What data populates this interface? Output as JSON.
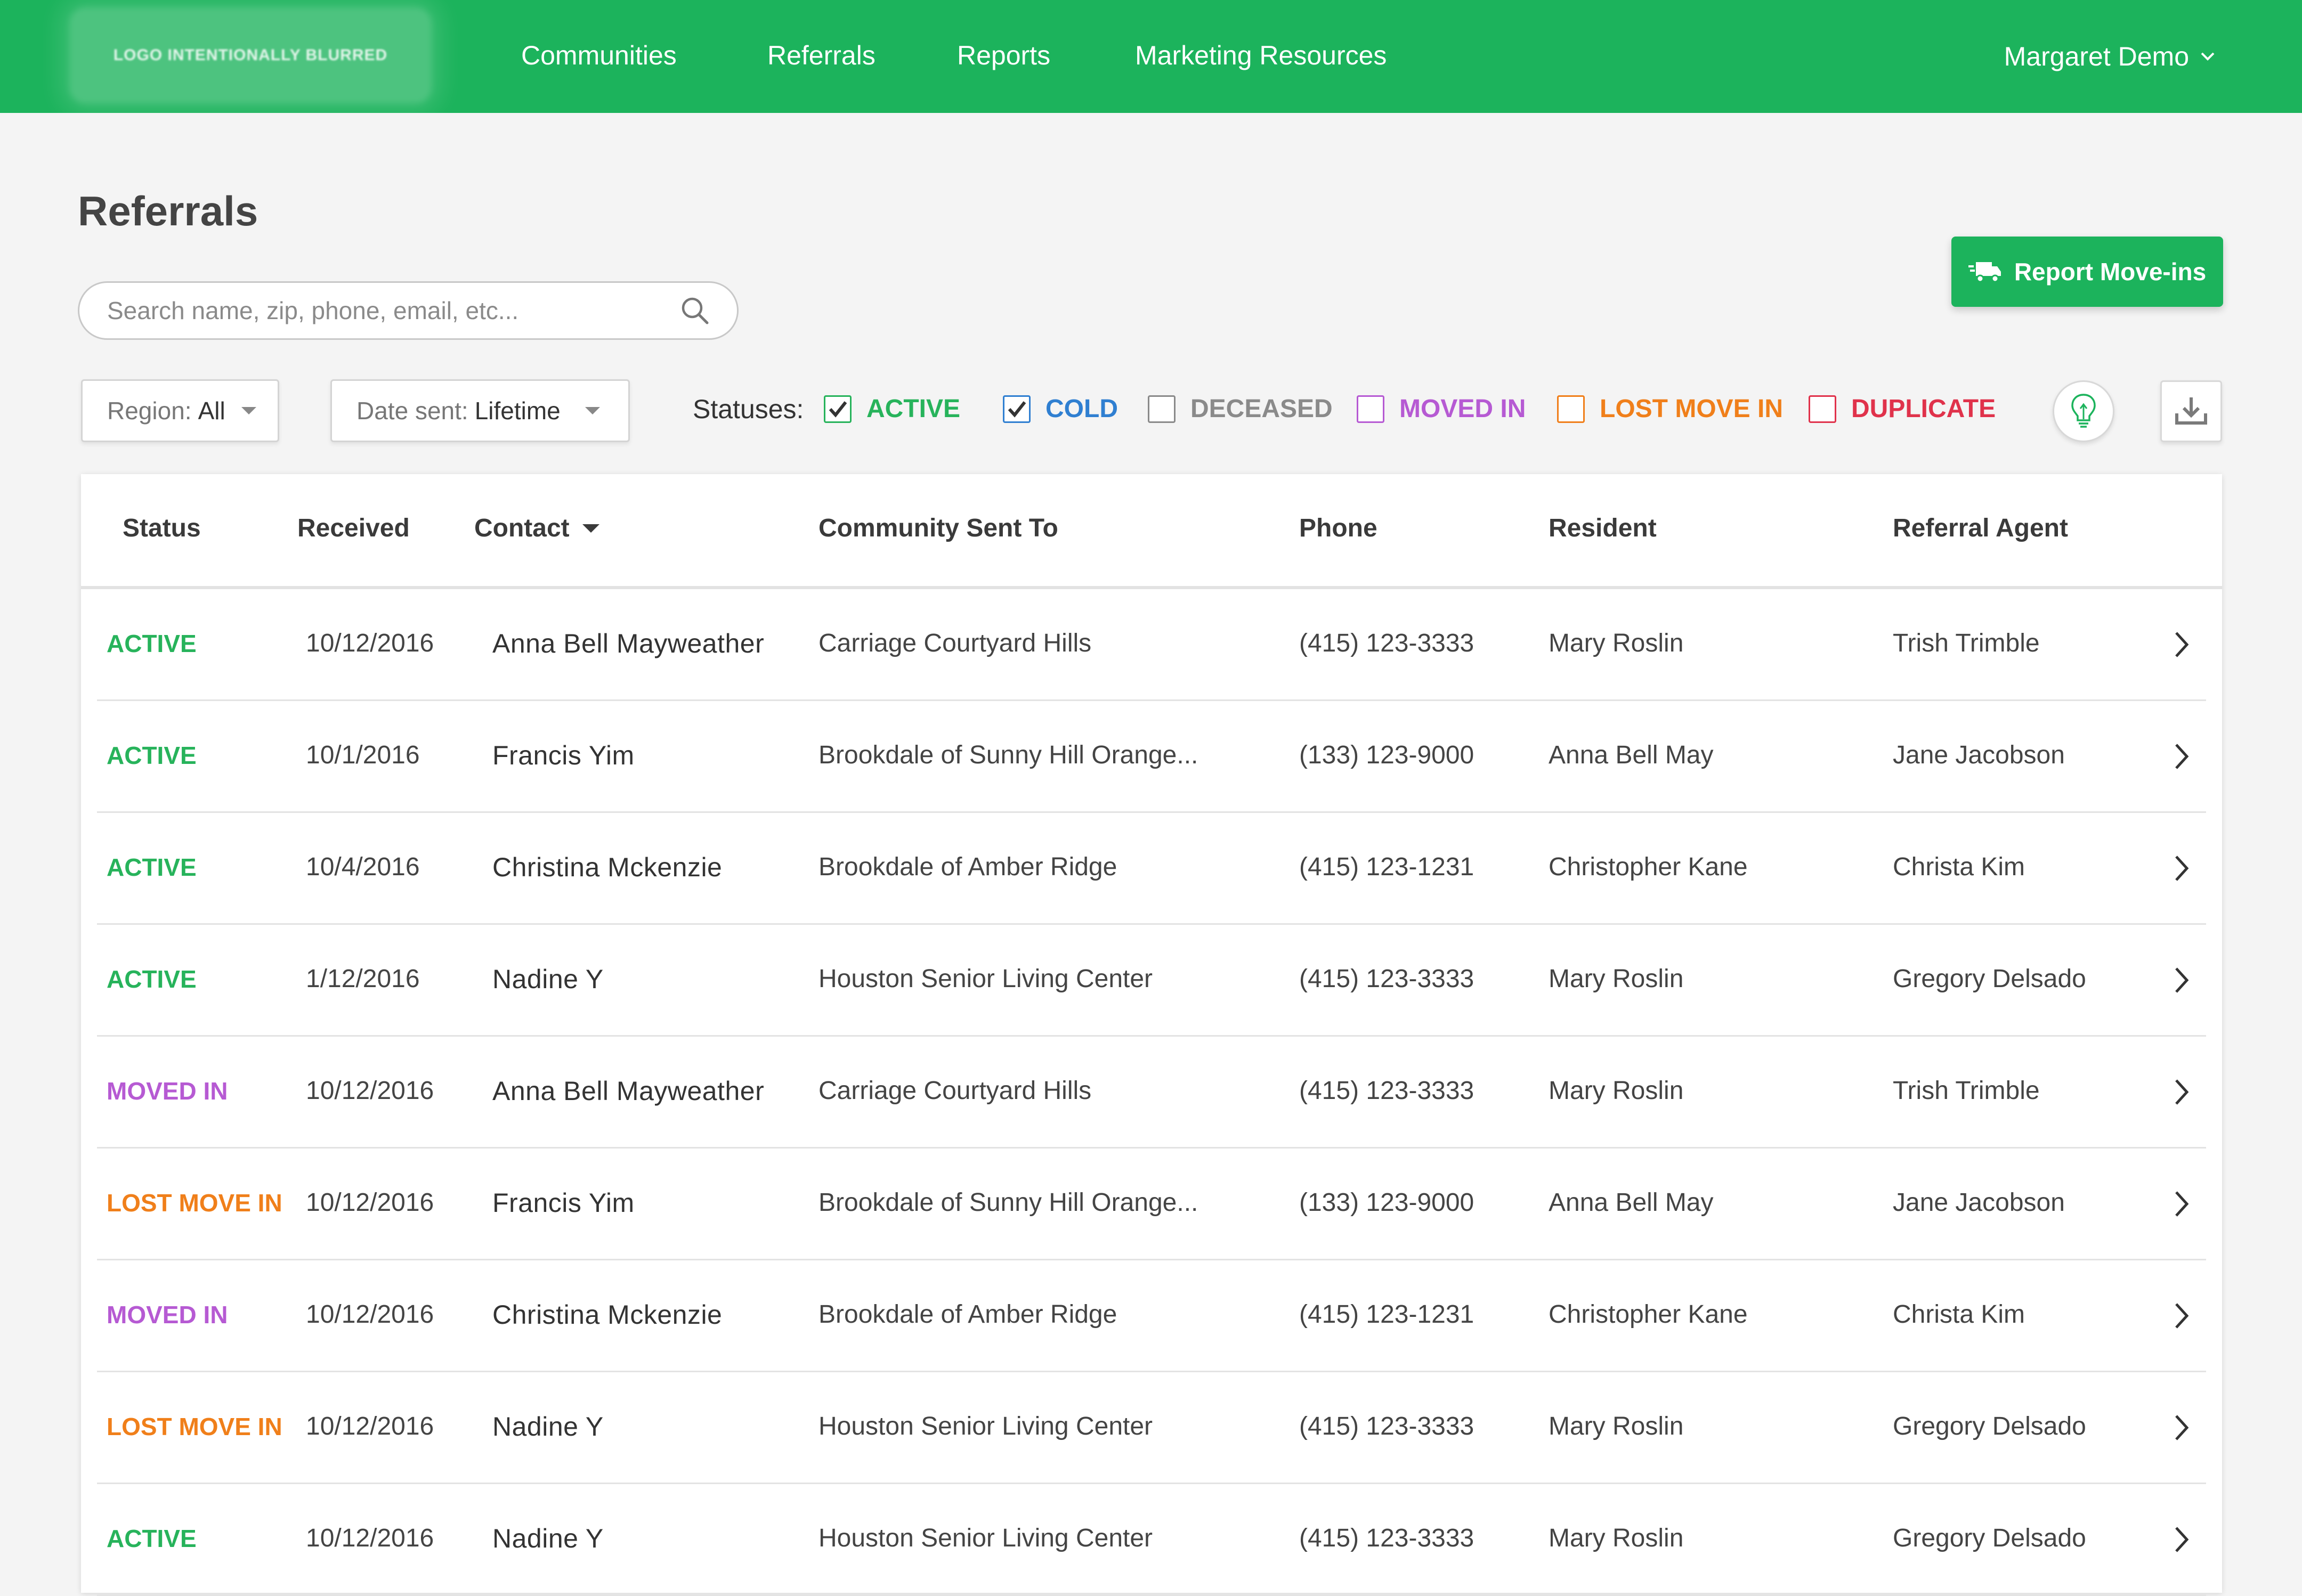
{
  "colors": {
    "brand": "#1cb35c",
    "active": "#27b35b",
    "cold": "#2f7fd1",
    "deceased": "#8a8a8a",
    "moved_in": "#b65ad3",
    "lost_move_in": "#f07f1a",
    "duplicate": "#e0324b"
  },
  "nav": {
    "logo_text": "LOGO INTENTIONALLY BLURRED",
    "links": [
      "Communities",
      "Referrals",
      "Reports",
      "Marketing Resources"
    ],
    "user_name": "Margaret Demo"
  },
  "page": {
    "title": "Referrals",
    "search_placeholder": "Search name, zip, phone, email, etc...",
    "report_button": "Report Move-ins"
  },
  "filters": {
    "region": {
      "label": "Region:",
      "value": "All"
    },
    "date_sent": {
      "label": "Date sent:",
      "value": "Lifetime"
    },
    "statuses_label": "Statuses:",
    "statuses": [
      {
        "label": "ACTIVE",
        "checked": true,
        "color": "#27b35b"
      },
      {
        "label": "COLD",
        "checked": true,
        "color": "#2f7fd1"
      },
      {
        "label": "DECEASED",
        "checked": false,
        "color": "#8a8a8a"
      },
      {
        "label": "MOVED IN",
        "checked": false,
        "color": "#b65ad3"
      },
      {
        "label": "LOST MOVE IN",
        "checked": false,
        "color": "#f07f1a"
      },
      {
        "label": "DUPLICATE",
        "checked": false,
        "color": "#e0324b"
      }
    ],
    "tips_icon": "lightbulb-icon",
    "download_icon": "download-icon"
  },
  "table": {
    "headers": [
      "Status",
      "Received",
      "Contact",
      "Community Sent To",
      "Phone",
      "Resident",
      "Referral Agent"
    ],
    "rows": [
      {
        "status": "ACTIVE",
        "received": "10/12/2016",
        "contact": "Anna Bell Mayweather",
        "community": "Carriage Courtyard Hills",
        "phone": "(415) 123-3333",
        "resident": "Mary Roslin",
        "agent": "Trish Trimble"
      },
      {
        "status": "ACTIVE",
        "received": "10/1/2016",
        "contact": "Francis Yim",
        "community": "Brookdale of Sunny Hill Orange...",
        "phone": "(133) 123-9000",
        "resident": "Anna Bell May",
        "agent": "Jane Jacobson"
      },
      {
        "status": "ACTIVE",
        "received": "10/4/2016",
        "contact": "Christina Mckenzie",
        "community": "Brookdale of Amber Ridge",
        "phone": "(415) 123-1231",
        "resident": "Christopher Kane",
        "agent": "Christa Kim"
      },
      {
        "status": "ACTIVE",
        "received": "1/12/2016",
        "contact": "Nadine Y",
        "community": "Houston Senior Living Center",
        "phone": "(415) 123-3333",
        "resident": "Mary Roslin",
        "agent": "Gregory Delsado"
      },
      {
        "status": "MOVED IN",
        "received": "10/12/2016",
        "contact": "Anna Bell Mayweather",
        "community": "Carriage Courtyard Hills",
        "phone": "(415) 123-3333",
        "resident": "Mary Roslin",
        "agent": "Trish Trimble"
      },
      {
        "status": "LOST MOVE IN",
        "received": "10/12/2016",
        "contact": "Francis Yim",
        "community": "Brookdale of Sunny Hill Orange...",
        "phone": "(133) 123-9000",
        "resident": "Anna Bell May",
        "agent": "Jane Jacobson"
      },
      {
        "status": "MOVED IN",
        "received": "10/12/2016",
        "contact": "Christina Mckenzie",
        "community": "Brookdale of Amber Ridge",
        "phone": "(415) 123-1231",
        "resident": "Christopher Kane",
        "agent": "Christa Kim"
      },
      {
        "status": "LOST MOVE IN",
        "received": "10/12/2016",
        "contact": "Nadine Y",
        "community": "Houston Senior Living Center",
        "phone": "(415) 123-3333",
        "resident": "Mary Roslin",
        "agent": "Gregory Delsado"
      },
      {
        "status": "ACTIVE",
        "received": "10/12/2016",
        "contact": "Nadine Y",
        "community": "Houston Senior Living Center",
        "phone": "(415) 123-3333",
        "resident": "Mary Roslin",
        "agent": "Gregory Delsado"
      }
    ]
  }
}
